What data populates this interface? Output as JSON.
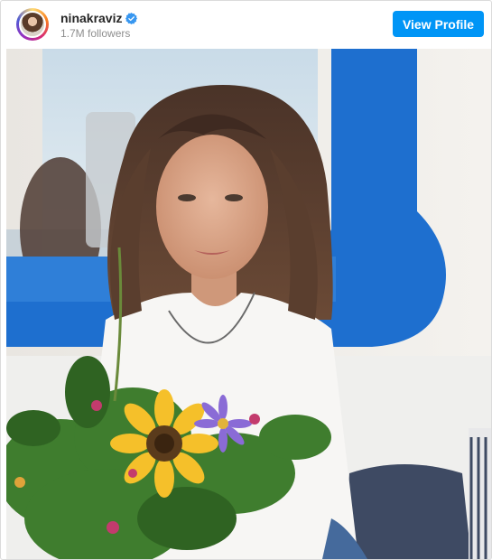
{
  "profile": {
    "username": "ninakraviz",
    "followers_text": "1.7M followers",
    "verified": true
  },
  "header": {
    "view_profile_label": "View Profile"
  },
  "colors": {
    "accent_button": "#0095f6",
    "verified_badge": "#3897f0",
    "window_frame_blue": "#1e6fcf"
  },
  "post": {
    "photo_description_icon": "photo-image"
  }
}
